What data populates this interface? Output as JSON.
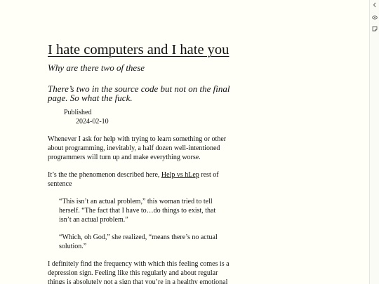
{
  "article": {
    "title": "I hate computers and I hate you",
    "subtitle": "Why are there two of these",
    "subtitle2": "There’s two in the source code but not on the final page. So what the fuck.",
    "published_label": "Published",
    "published_date": "2024-02-10",
    "paragraph1": "Whenever I ask for help with trying to learn something or other about programming, inevitably, a half dozen well-intentioned programmers will turn up and make everything worse.",
    "paragraph2_before": "It’s the the phenomenon described here, ",
    "paragraph2_link": "Help vs hLep",
    "paragraph2_after": " rest of sentence",
    "quote1": "“This isn’t an actual problem,” this woman tried to tell herself. “The fact that I have to…do things to exist, that isn’t an actual problem.”",
    "quote2": "“Which, oh God,” she realized, “means there’s no actual solution.”",
    "paragraph3": "I definitely find the frequency with which this feeling comes is a depression sign. Feeling like this regularly and about regular things is absolutely not a sign that you’re in a healthy emotional state."
  },
  "sidebar": {
    "collapse_icon": "chevron-left-icon",
    "view_icon": "eye-icon",
    "notes_icon": "note-icon"
  }
}
